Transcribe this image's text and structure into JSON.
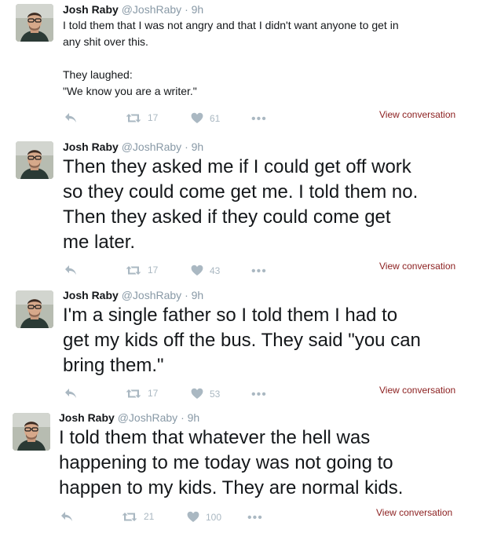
{
  "tweets": [
    {
      "name": "Josh Raby",
      "handle": "@JoshRaby",
      "dot": "·",
      "time": "9h",
      "lines": [
        "I told them that I was not angry and that I didn't want anyone to get in",
        "any shit over this.",
        "",
        "They laughed:",
        "\"We know you are a writer.\""
      ],
      "retweets": "17",
      "likes": "61",
      "more": "•••",
      "view": "View conversation"
    },
    {
      "name": "Josh Raby",
      "handle": "@JoshRaby",
      "dot": "·",
      "time": "9h",
      "lines": [
        "Then they asked me if I could get off work",
        "so they could come get me. I told them no.",
        "Then they asked if they could come get",
        "me later."
      ],
      "retweets": "17",
      "likes": "43",
      "more": "•••",
      "view": "View conversation"
    },
    {
      "name": "Josh Raby",
      "handle": "@JoshRaby",
      "dot": "·",
      "time": "9h",
      "lines": [
        "I'm a single father so I told them I had to",
        "get my kids off the bus. They said \"you can",
        "bring them.\""
      ],
      "retweets": "17",
      "likes": "53",
      "more": "•••",
      "view": "View conversation"
    },
    {
      "name": "Josh Raby",
      "handle": "@JoshRaby",
      "dot": "·",
      "time": "9h",
      "lines": [
        "I told them that whatever the hell was",
        "happening to me today was not going to",
        "happen to my kids. They are normal kids."
      ],
      "retweets": "21",
      "likes": "100",
      "more": "•••",
      "view": "View conversation"
    }
  ],
  "icons": {
    "reply": "reply-icon",
    "retweet": "retweet-icon",
    "like": "heart-icon",
    "more": "more-icon",
    "avatar": "profile-photo"
  },
  "colors": {
    "icon_gray": "#aab8c2",
    "meta_gray": "#8899a6",
    "link_red": "#8b1e1e"
  }
}
